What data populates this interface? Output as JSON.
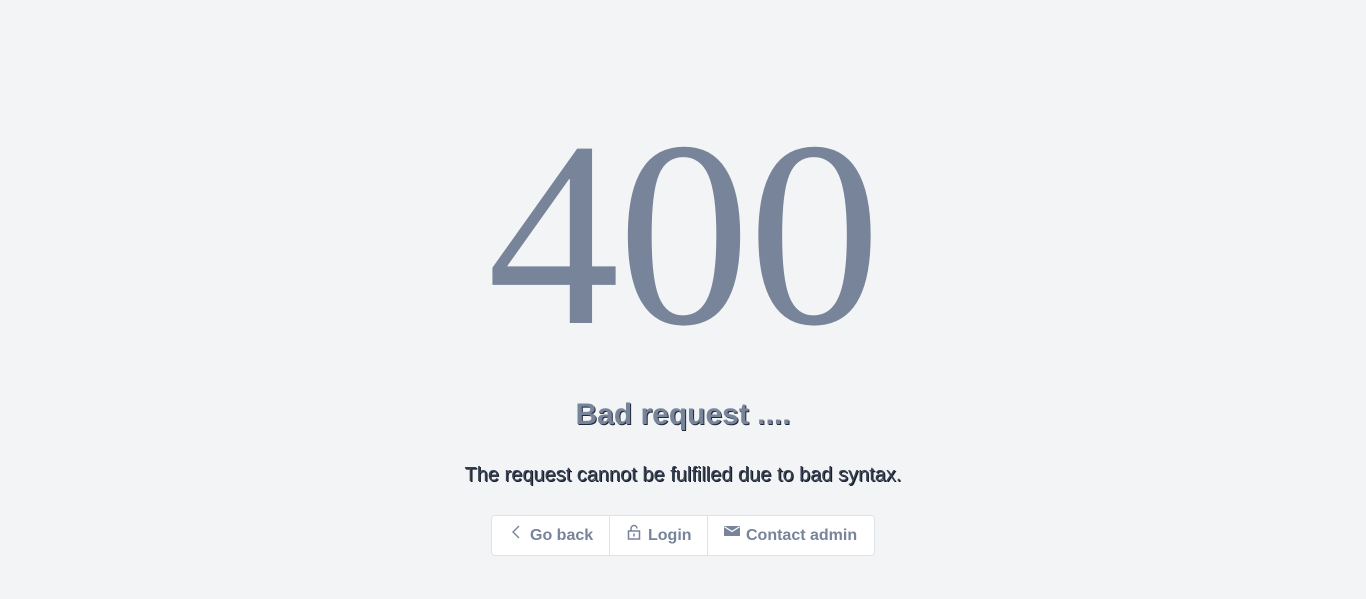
{
  "error": {
    "code": "400",
    "title": "Bad request ....",
    "message": "The request cannot be fulfilled due to bad syntax."
  },
  "actions": {
    "back": {
      "label": "Go back",
      "icon": "chevron-left-icon"
    },
    "login": {
      "label": "Login",
      "icon": "lock-icon"
    },
    "contact": {
      "label": "Contact admin",
      "icon": "mail-icon"
    }
  },
  "colors": {
    "background": "#f3f4f6",
    "accent": "#77849a",
    "text_dark": "#374151",
    "border": "#dfe3e8"
  }
}
